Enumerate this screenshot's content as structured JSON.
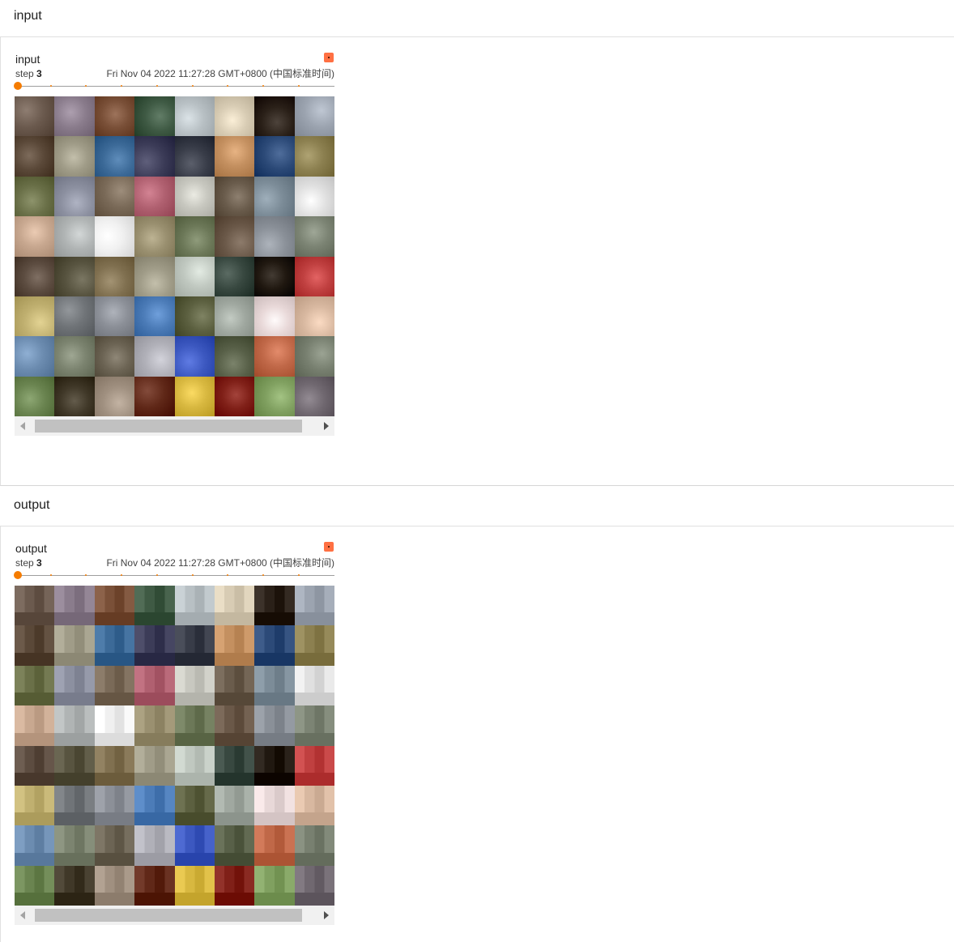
{
  "colors": {
    "accent": "#f57c00",
    "expand_button": "#ff7043",
    "divider": "#e0e0e0"
  },
  "sections": [
    {
      "header": "input",
      "card": {
        "title": "input",
        "step_label": "step",
        "step_value": "3",
        "timestamp": "Fri Nov 04 2022 11:27:28 GMT+0800 (中国标准时间)"
      }
    },
    {
      "header": "output",
      "card": {
        "title": "output",
        "step_label": "step",
        "step_value": "3",
        "timestamp": "Fri Nov 04 2022 11:27:28 GMT+0800 (中国标准时间)"
      }
    }
  ],
  "image_grid": {
    "rows": 8,
    "cols": 8,
    "cells": [
      [
        "#6b5a4e",
        "#8a7c8c",
        "#7a5038",
        "#3f5a44",
        "#b8c0c4",
        "#d8ccb4",
        "#2a2018",
        "#9ca4b0"
      ],
      [
        "#5a4838",
        "#a09c88",
        "#3c6a98",
        "#3c3c58",
        "#383c48",
        "#c49060",
        "#2c4a78",
        "#8c8050"
      ],
      [
        "#6a7048",
        "#8c90a0",
        "#7a6a58",
        "#b06070",
        "#c8c8c0",
        "#6a5c4c",
        "#7c8c98",
        "#e0e0e0"
      ],
      [
        "#c8a890",
        "#b0b4b4",
        "#f0f0f0",
        "#9a9070",
        "#6c7858",
        "#6a5848",
        "#8a9098",
        "#7c8474"
      ],
      [
        "#5c4c40",
        "#585440",
        "#807050",
        "#a09c88",
        "#c0c8c0",
        "#384840",
        "#201810",
        "#c04040"
      ],
      [
        "#c0b070",
        "#707478",
        "#8c9098",
        "#4c7cb8",
        "#5c6040",
        "#a0a8a0",
        "#e8d8d8",
        "#d8b8a0"
      ],
      [
        "#6c8cb0",
        "#7c8470",
        "#6c6454",
        "#b0b0b8",
        "#3c58c0",
        "#586048",
        "#c06848",
        "#788070"
      ],
      [
        "#6a8450",
        "#403828",
        "#a09080",
        "#602818",
        "#d8b840",
        "#802018",
        "#80a060",
        "#706870"
      ]
    ]
  }
}
